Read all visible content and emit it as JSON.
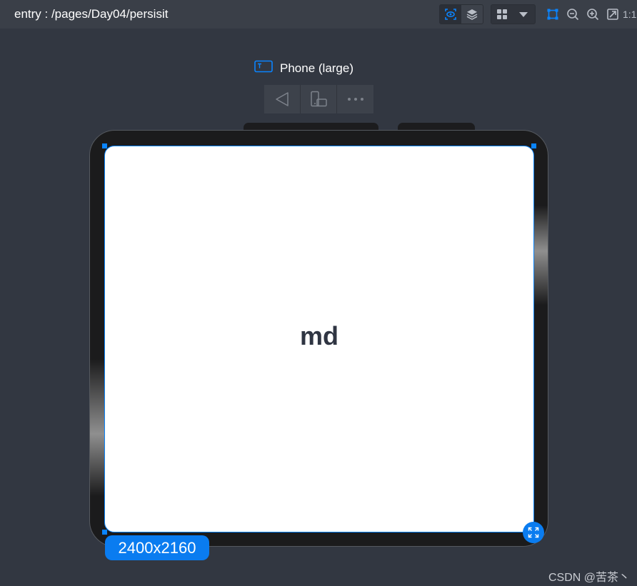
{
  "topbar": {
    "path": "entry : /pages/Day04/persisit",
    "tools": {
      "preview_icon": "eye-scan-icon",
      "layers_icon": "layers-icon",
      "grid_icon": "grid-icon",
      "dropdown_icon": "caret-down-icon",
      "select_icon": "select-frame-icon",
      "zoom_out_icon": "zoom-out-icon",
      "zoom_in_icon": "zoom-in-icon",
      "fit_icon": "fit-screen-icon",
      "ratio_label": "1:1"
    }
  },
  "device": {
    "label": "Phone (large)",
    "label_icon": "device-tag-icon",
    "controls": [
      "back-icon",
      "rotate-device-icon",
      "more-icon"
    ],
    "screen_text": "md",
    "size_badge": "2400x2160",
    "expand_icon": "expand-icon"
  },
  "watermark": "CSDN @苦茶丶",
  "colors": {
    "background": "#323741",
    "topbar": "#3a3f48",
    "accent": "#0a7cf0",
    "screen": "#ffffff",
    "frame": "#1b1b1c"
  }
}
